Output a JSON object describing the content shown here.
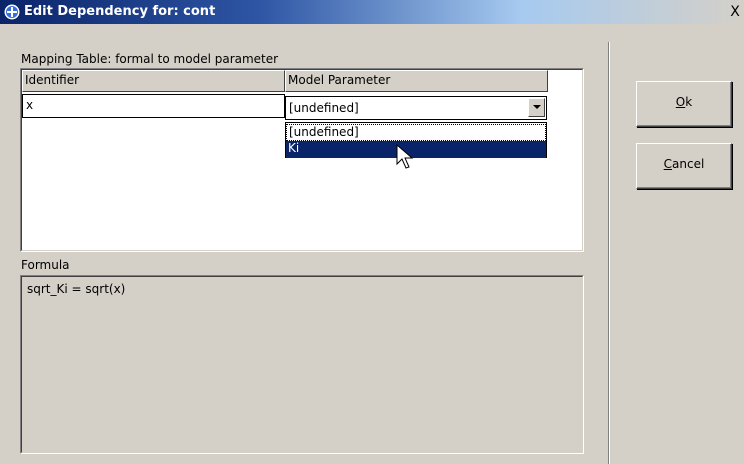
{
  "window": {
    "title": "Edit Dependency for: cont",
    "close_glyph": "X"
  },
  "mapping": {
    "label": "Mapping Table: formal to model parameter",
    "columns": [
      "Identifier",
      "Model Parameter"
    ],
    "rows": [
      {
        "identifier": "x",
        "model_parameter": "[undefined]"
      }
    ],
    "dropdown_options": [
      "[undefined]",
      "Ki"
    ],
    "highlighted_option": "Ki"
  },
  "formula": {
    "label": "Formula",
    "text": "sqrt_Ki = sqrt(x)"
  },
  "buttons": {
    "ok_label": "Ok",
    "ok_mnemonic": "O",
    "cancel_label": "Cancel",
    "cancel_mnemonic": "C"
  },
  "colors": {
    "title_bar": "#0a246a",
    "selection": "#0a246a",
    "face": "#d4d0c8"
  },
  "icons": {
    "title": "plus-circle-icon",
    "cursor": "mouse-pointer-icon"
  }
}
